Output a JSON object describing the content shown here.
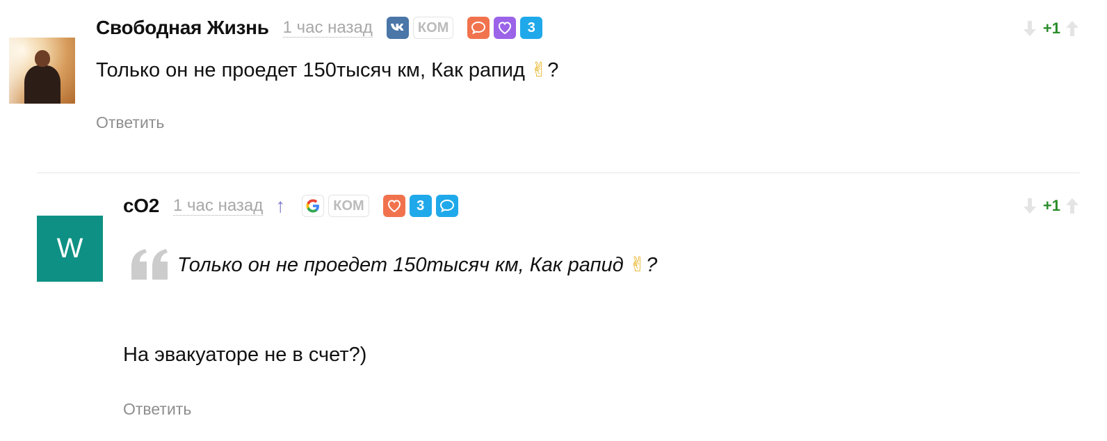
{
  "comments": [
    {
      "author": "Свободная Жизнь",
      "time": "1 час назад",
      "text_main": "Только он не проедет 150тысяч км, Как рапид ",
      "text_emoji": "✌",
      "text_end": "?",
      "reply_label": "Ответить",
      "score": "+1",
      "badges": {
        "kom": "КОМ",
        "count": "3"
      }
    },
    {
      "author": "cO2",
      "time": "1 час назад",
      "reply_arrow": "↑",
      "avatar_letter": "W",
      "quote_main": "Только он не проедет 150тысяч км, Как рапид ",
      "quote_emoji": "✌",
      "quote_end": "?",
      "text": "На эвакуаторе не в счет?)",
      "reply_label": "Ответить",
      "score": "+1",
      "badges": {
        "kom": "КОМ",
        "count": "3"
      }
    }
  ],
  "colors": {
    "vk": "#4a76a8",
    "orange": "#f1734d",
    "purple": "#9b63e8",
    "blue": "#1fa9ea",
    "avatar_teal": "#0e9184",
    "score_green": "#2a8c2a"
  },
  "icons": [
    "vk-icon",
    "google-icon",
    "comment-icon",
    "heart-icon",
    "quote-icon",
    "vote-down-icon",
    "vote-up-icon",
    "reply-arrow-icon"
  ]
}
